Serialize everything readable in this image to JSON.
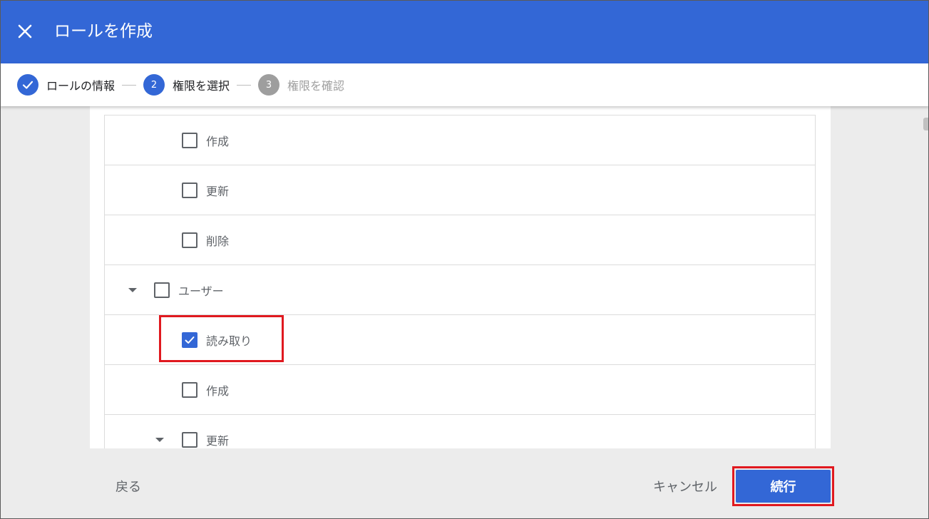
{
  "header": {
    "title": "ロールを作成",
    "close_icon": "close-icon",
    "background": "#3367d6"
  },
  "stepper": {
    "steps": [
      {
        "number": "",
        "label": "ロールの情報",
        "state": "completed"
      },
      {
        "number": "2",
        "label": "権限を選択",
        "state": "active"
      },
      {
        "number": "3",
        "label": "権限を確認",
        "state": "inactive"
      }
    ]
  },
  "permissions": {
    "rows": [
      {
        "label": "作成",
        "checked": false,
        "expandable": false
      },
      {
        "label": "更新",
        "checked": false,
        "expandable": false
      },
      {
        "label": "削除",
        "checked": false,
        "expandable": false
      },
      {
        "label": "ユーザー",
        "checked": false,
        "expandable": true
      },
      {
        "label": "読み取り",
        "checked": true,
        "expandable": false
      },
      {
        "label": "作成",
        "checked": false,
        "expandable": false
      },
      {
        "label": "更新",
        "checked": false,
        "expandable": true
      }
    ]
  },
  "footer": {
    "back_label": "戻る",
    "cancel_label": "キャンセル",
    "continue_label": "続行"
  },
  "colors": {
    "accent": "#3367d6",
    "highlight": "#e0191f",
    "inactive": "#9e9e9e"
  }
}
